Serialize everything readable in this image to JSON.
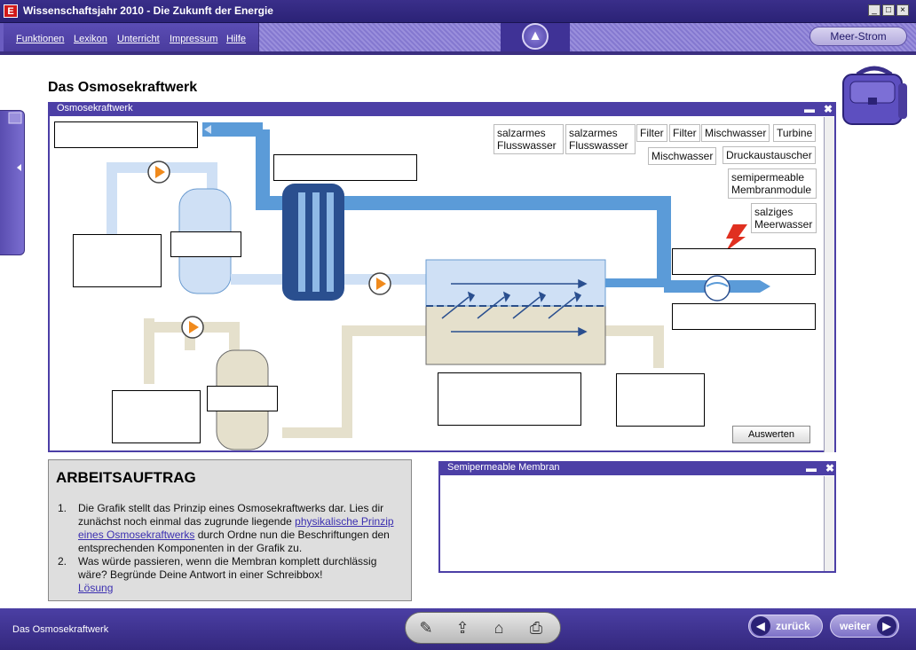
{
  "window": {
    "badge": "E",
    "title": "Wissenschaftsjahr 2010 - Die Zukunft der Energie",
    "btn_min": "_",
    "btn_max": "□",
    "btn_close": "×"
  },
  "menu": {
    "items": [
      "Funktionen",
      "Lexikon",
      "Unterricht",
      "Impressum",
      "Hilfe"
    ],
    "up_label": "▲",
    "right_button": "Meer-Strom"
  },
  "page": {
    "title": "Das Osmosekraftwerk"
  },
  "main_window": {
    "title": "Osmosekraftwerk",
    "minimize": "▬",
    "close": "✖",
    "evaluate_button": "Auswerten"
  },
  "labels": {
    "row1": [
      "salzarmes Flusswasser",
      "salzarmes Flusswasser",
      "Filter",
      "Filter",
      "Mischwasser",
      "Turbine"
    ],
    "row2": [
      "Mischwasser",
      "Druckaustauscher"
    ],
    "row3": [
      "semipermeable Membranmodule"
    ],
    "row4": [
      "salziges Meerwasser"
    ]
  },
  "task": {
    "heading": "ARBEITSAUFTRAG",
    "item1_num": "1.",
    "item1_a": "Die Grafik stellt das Prinzip eines Osmosekraftwerks dar. Lies dir zunächst noch einmal das zugrunde liegende ",
    "item1_link": "physikalische Prinzip eines Osmosekraftwerks",
    "item1_b": " durch Ordne nun die Beschriftungen den entsprechenden Komponenten in der Grafik zu.",
    "item2_num": "2.",
    "item2": "Was würde passieren, wenn die Membran komplett durchlässig wäre? Begründe Deine Antwort in einer Schreibbox!",
    "solution_link": "Lösung"
  },
  "membrane_window": {
    "title": "Semipermeable Membran",
    "minimize": "▬",
    "close": "✖"
  },
  "bottom": {
    "label": "Das Osmosekraftwerk",
    "back": "zurück",
    "next": "weiter",
    "back_arrow": "◀",
    "next_arrow": "▶"
  },
  "colors": {
    "accent": "#4c3fa6",
    "water_blue": "#5b9bd8",
    "light_blue": "#cfe0f5",
    "beige": "#e5e0cc",
    "pump_orange": "#f08a1c"
  }
}
